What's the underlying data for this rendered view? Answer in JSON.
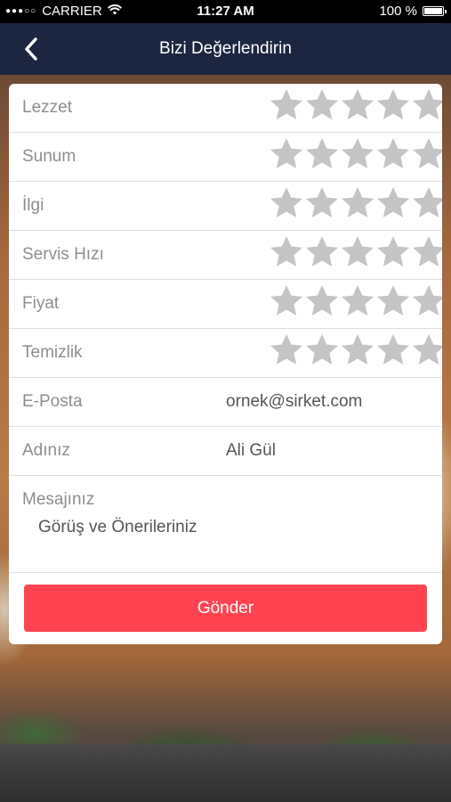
{
  "status_bar": {
    "carrier": "CARRIER",
    "time": "11:27 AM",
    "battery": "100 %"
  },
  "nav": {
    "title": "Bizi Değerlendirin",
    "back_icon": "chevron-left-icon"
  },
  "ratings": [
    {
      "label": "Lezzet",
      "stars": 0,
      "max": 5
    },
    {
      "label": "Sunum",
      "stars": 0,
      "max": 5
    },
    {
      "label": "İlgi",
      "stars": 0,
      "max": 5
    },
    {
      "label": "Servis Hızı",
      "stars": 0,
      "max": 5
    },
    {
      "label": "Fiyat",
      "stars": 0,
      "max": 5
    },
    {
      "label": "Temizlik",
      "stars": 0,
      "max": 5
    }
  ],
  "form": {
    "email_label": "E-Posta",
    "email_value": "ornek@sirket.com",
    "name_label": "Adınız",
    "name_value": "Ali Gül",
    "message_label": "Mesajınız",
    "message_placeholder": "Görüş ve Önerileriniz"
  },
  "submit_label": "Gönder",
  "colors": {
    "nav_bg": "#1d2640",
    "star_inactive": "#c4c4c4",
    "button": "#ff4351"
  }
}
